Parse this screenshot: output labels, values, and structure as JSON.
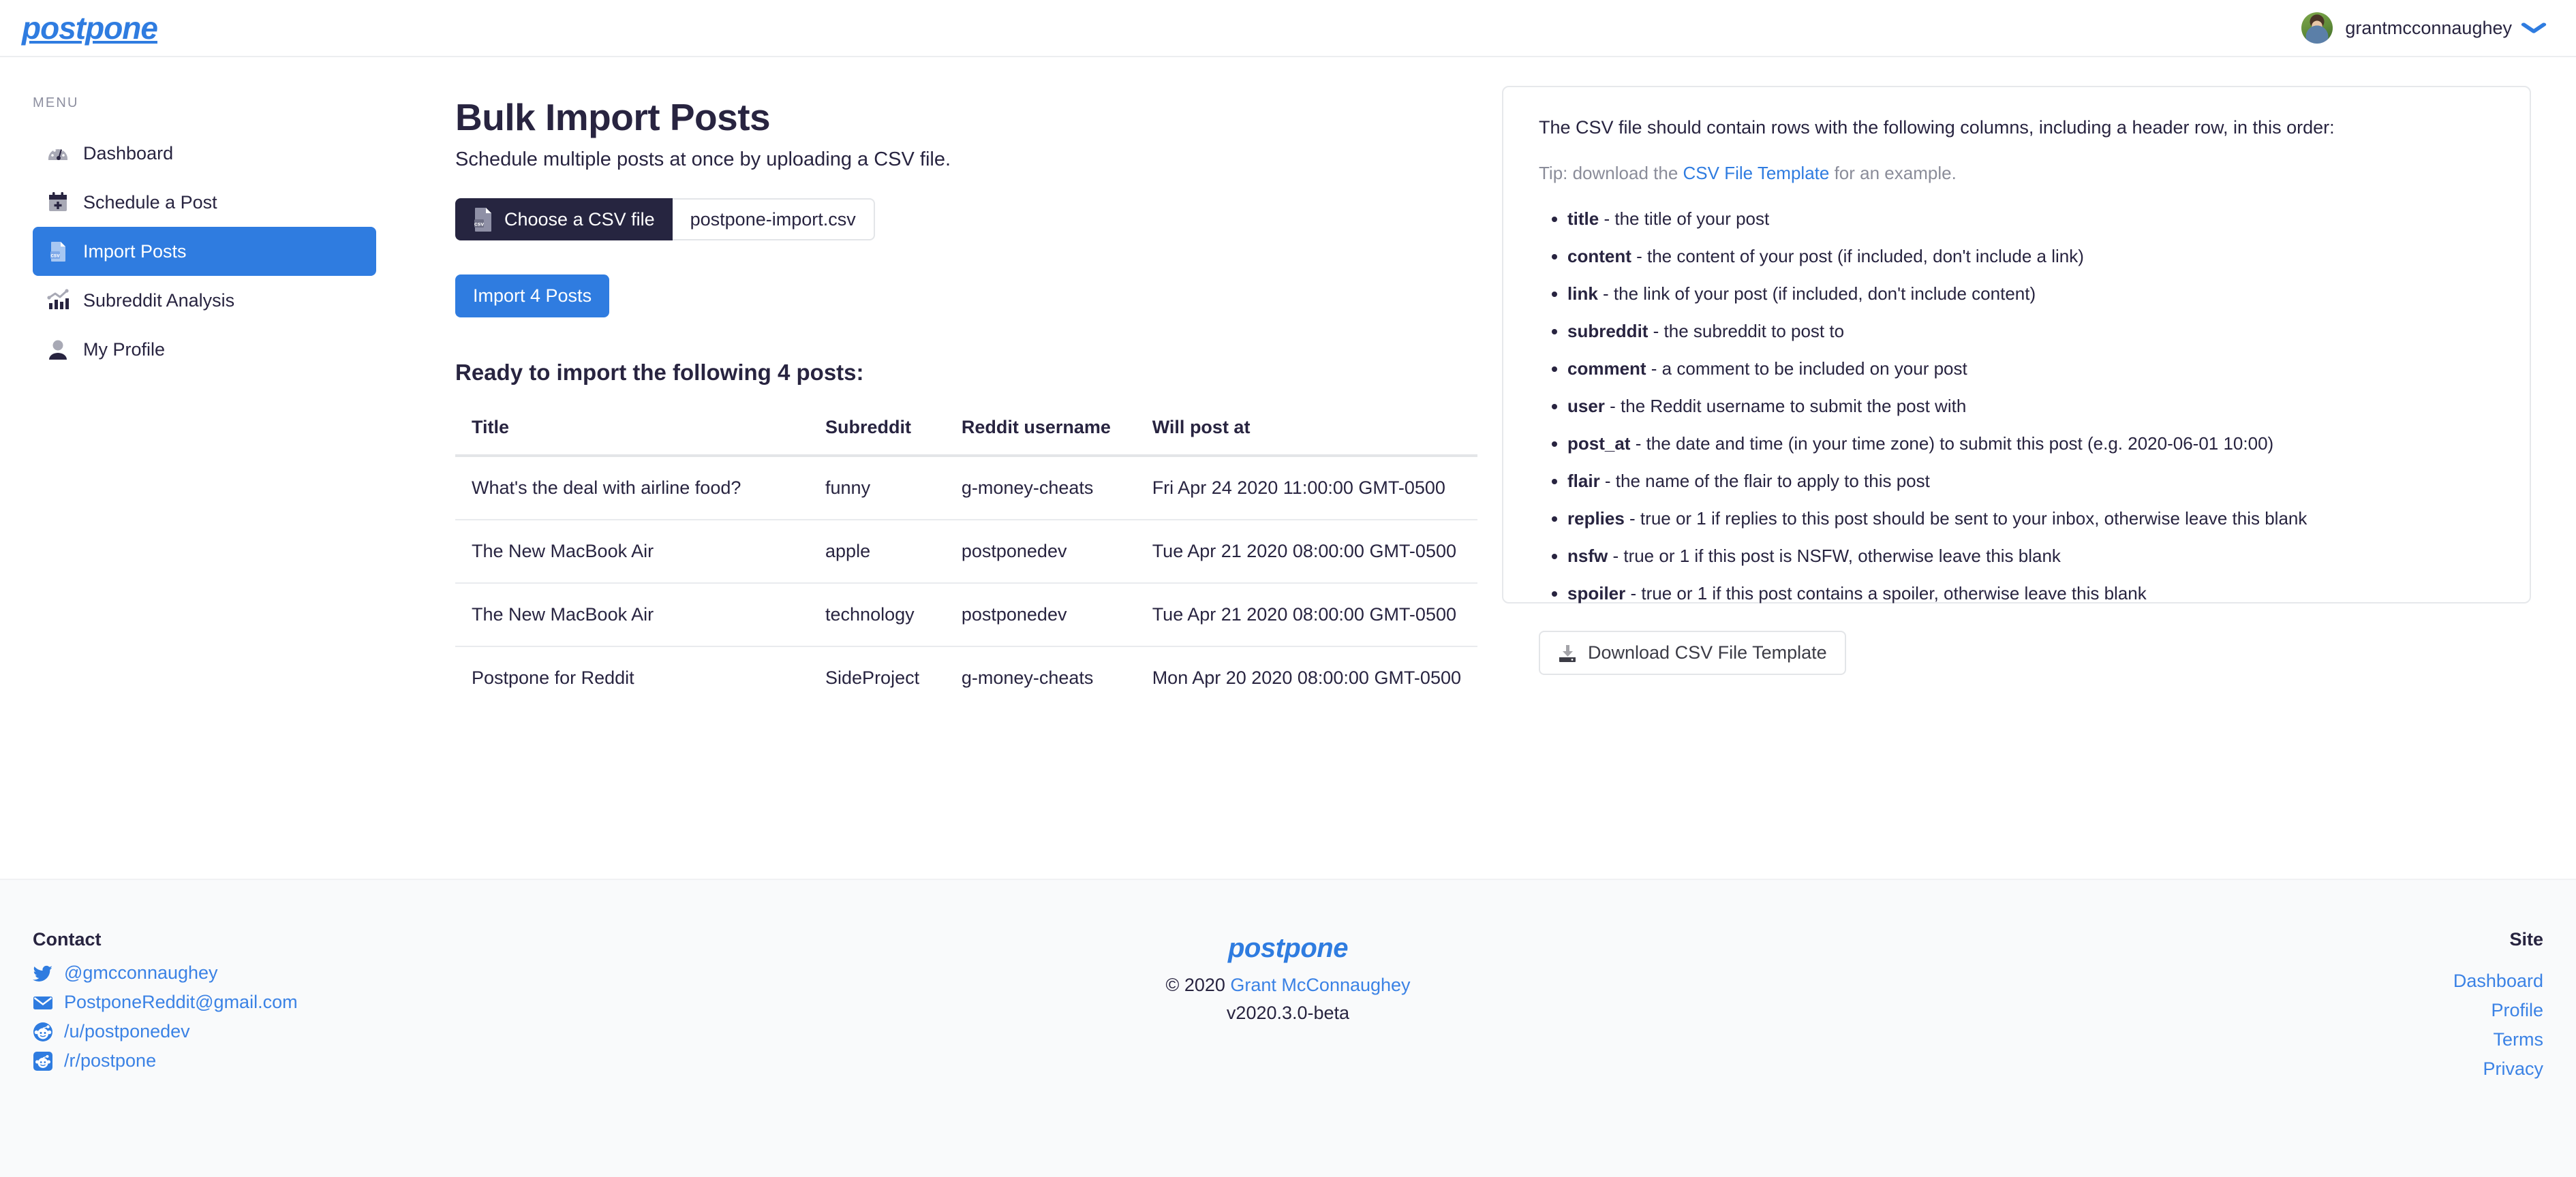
{
  "header": {
    "brand": "postpone",
    "username": "grantmcconnaughey",
    "chevron": "❯"
  },
  "sidebar": {
    "menu_label": "MENU",
    "items": [
      {
        "label": "Dashboard",
        "icon": "gauge-icon",
        "active": false
      },
      {
        "label": "Schedule a Post",
        "icon": "calendar-plus-icon",
        "active": false
      },
      {
        "label": "Import Posts",
        "icon": "csv-file-icon",
        "active": true
      },
      {
        "label": "Subreddit Analysis",
        "icon": "bar-chart-icon",
        "active": false
      },
      {
        "label": "My Profile",
        "icon": "user-icon",
        "active": false
      }
    ]
  },
  "main": {
    "title": "Bulk Import Posts",
    "subtitle": "Schedule multiple posts at once by uploading a CSV file.",
    "choose_file_label": "Choose a CSV file",
    "chosen_file_name": "postpone-import.csv",
    "import_button_label": "Import 4 Posts",
    "ready_heading": "Ready to import the following 4 posts:",
    "table": {
      "columns": [
        "Title",
        "Subreddit",
        "Reddit username",
        "Will post at"
      ],
      "rows": [
        {
          "title": "What's the deal with airline food?",
          "subreddit": "funny",
          "username": "g-money-cheats",
          "post_at": "Fri Apr 24 2020 11:00:00 GMT-0500"
        },
        {
          "title": "The New MacBook Air",
          "subreddit": "apple",
          "username": "postponedev",
          "post_at": "Tue Apr 21 2020 08:00:00 GMT-0500"
        },
        {
          "title": "The New MacBook Air",
          "subreddit": "technology",
          "username": "postponedev",
          "post_at": "Tue Apr 21 2020 08:00:00 GMT-0500"
        },
        {
          "title": "Postpone for Reddit",
          "subreddit": "SideProject",
          "username": "g-money-cheats",
          "post_at": "Mon Apr 20 2020 08:00:00 GMT-0500"
        }
      ]
    }
  },
  "info_panel": {
    "lead": "The CSV file should contain rows with the following columns, including a header row, in this order:",
    "tip_before": "Tip: download the ",
    "tip_link": "CSV File Template",
    "tip_after": " for an example.",
    "columns": [
      {
        "name": "title",
        "desc": " - the title of your post"
      },
      {
        "name": "content",
        "desc": " - the content of your post (if included, don't include a link)"
      },
      {
        "name": "link",
        "desc": " - the link of your post (if included, don't include content)"
      },
      {
        "name": "subreddit",
        "desc": " - the subreddit to post to"
      },
      {
        "name": "comment",
        "desc": " - a comment to be included on your post"
      },
      {
        "name": "user",
        "desc": " - the Reddit username to submit the post with"
      },
      {
        "name": "post_at",
        "desc": " - the date and time (in your time zone) to submit this post (e.g. 2020-06-01 10:00)"
      },
      {
        "name": "flair",
        "desc": " - the name of the flair to apply to this post"
      },
      {
        "name": "replies",
        "desc": " - true or 1 if replies to this post should be sent to your inbox, otherwise leave this blank"
      },
      {
        "name": "nsfw",
        "desc": " - true or 1 if this post is NSFW, otherwise leave this blank"
      },
      {
        "name": "spoiler",
        "desc": " - true or 1 if this post contains a spoiler, otherwise leave this blank"
      }
    ],
    "download_button_label": "Download CSV File Template"
  },
  "footer": {
    "contact_heading": "Contact",
    "contact_links": [
      {
        "label": "@gmcconnaughey",
        "icon": "twitter-icon"
      },
      {
        "label": "PostponeReddit@gmail.com",
        "icon": "envelope-icon"
      },
      {
        "label": "/u/postponedev",
        "icon": "reddit-circle-icon"
      },
      {
        "label": "/r/postpone",
        "icon": "reddit-square-icon"
      }
    ],
    "brand": "postpone",
    "copyright_prefix": "© 2020 ",
    "copyright_name": "Grant McConnaughey",
    "version": "v2020.3.0-beta",
    "site_heading": "Site",
    "site_links": [
      "Dashboard",
      "Profile",
      "Terms",
      "Privacy"
    ]
  },
  "colors": {
    "accent_blue": "#2f7ce0",
    "link_blue": "#3b82e5",
    "dark_navy": "#262540",
    "text": "#282440",
    "muted": "#8a8c99",
    "border": "#e3e5e8",
    "footer_bg": "#f9fafb"
  }
}
